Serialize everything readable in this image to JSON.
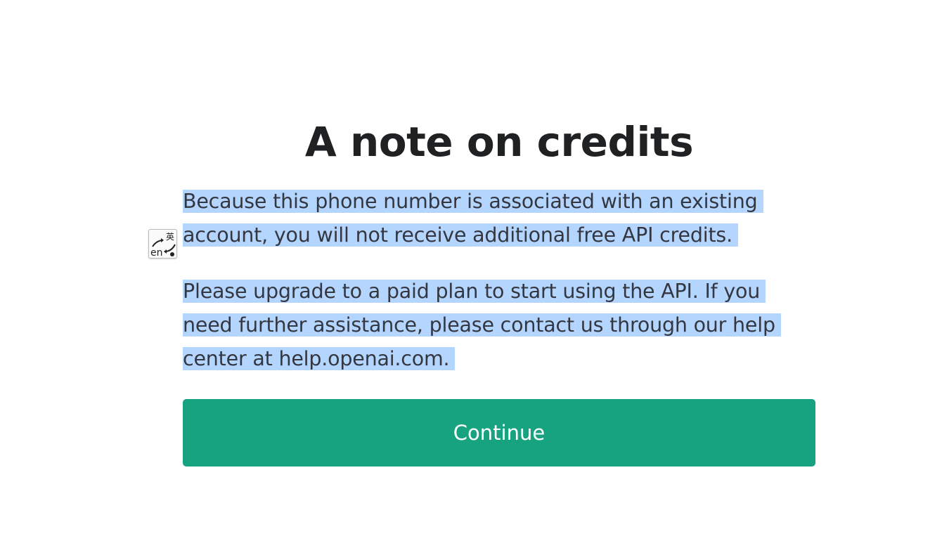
{
  "title": "A note on credits",
  "paragraphs": {
    "first": "Because this phone number is associated with an existing account, you will not receive additional free API credits.",
    "second": "Please upgrade to a paid plan to start using the API. If you need further assistance, please contact us through our help center at help.openai.com."
  },
  "continue_button": {
    "label": "Continue"
  },
  "translate_widget": {
    "icon": "translate-icon",
    "target_glyph": "英",
    "source_text": "en"
  },
  "colors": {
    "button": "#17a37f",
    "selection_highlight": "#b4d5fe",
    "heading": "#202123",
    "body_text": "#353740"
  }
}
